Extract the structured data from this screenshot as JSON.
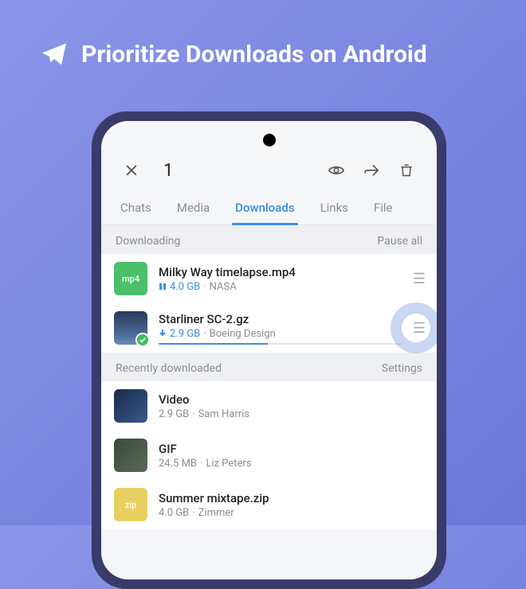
{
  "promo": {
    "title": "Prioritize Downloads on Android"
  },
  "topbar": {
    "selected_count": "1"
  },
  "tabs": [
    {
      "label": "Chats",
      "active": false
    },
    {
      "label": "Media",
      "active": false
    },
    {
      "label": "Downloads",
      "active": true
    },
    {
      "label": "Links",
      "active": false
    },
    {
      "label": "File",
      "active": false
    }
  ],
  "sections": {
    "downloading": {
      "title": "Downloading",
      "action": "Pause all"
    },
    "recent": {
      "title": "Recently downloaded",
      "action": "Settings"
    }
  },
  "downloads": [
    {
      "title": "Milky Way timelapse.mp4",
      "size": "4.0 GB",
      "source": "NASA",
      "status": "paused",
      "thumb": "mp4",
      "thumb_label": "mp4",
      "progress": 0
    },
    {
      "title": "Starliner SC-2.gz",
      "size": "2.9 GB",
      "source": "Boeing Design",
      "status": "downloading",
      "thumb": "globe",
      "progress": 45,
      "checked": true
    }
  ],
  "recent": [
    {
      "title": "Video",
      "size": "2.9 GB",
      "source": "Sam Harris",
      "thumb": "video"
    },
    {
      "title": "GIF",
      "size": "24.5 MB",
      "source": "Liz Peters",
      "thumb": "gif"
    },
    {
      "title": "Summer mixtape.zip",
      "size": "4.0 GB",
      "source": "Zimmer",
      "thumb": "zip",
      "thumb_label": "zip"
    }
  ]
}
